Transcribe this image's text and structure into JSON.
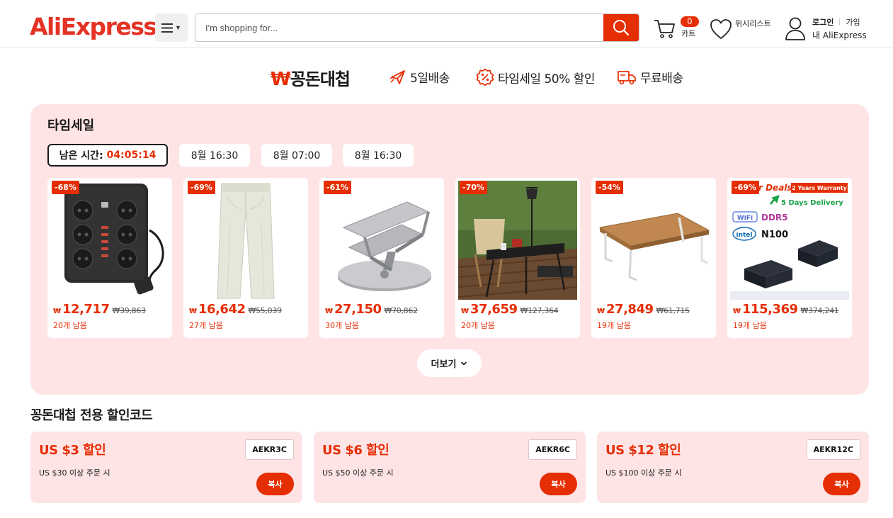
{
  "header": {
    "logo_text": "AliExpress",
    "logo_tm": "™",
    "search_placeholder": "I'm shopping for...",
    "cart_count": "0",
    "cart_label": "카트",
    "wishlist_label": "위시리스트",
    "login_label": "로그인",
    "join_label": "가입",
    "my_account_label": "내 AliExpress"
  },
  "banner": {
    "title_symbol": "₩",
    "title_text": "꽁돈대첩",
    "features": [
      {
        "icon": "airplane-icon",
        "label": "5일배송"
      },
      {
        "icon": "percent-badge-icon",
        "label": "타임세일 50% 할인"
      },
      {
        "icon": "truck-icon",
        "label": "무료배송"
      }
    ]
  },
  "timesale": {
    "title": "타임세일",
    "remaining_label": "남은 시간:",
    "countdown": "04:05:14",
    "slots": [
      "8월 16:30",
      "8월 07:00",
      "8월 16:30"
    ],
    "currency": "₩",
    "products": [
      {
        "name": "power strip",
        "discount": "-68%",
        "price": "12,717",
        "original": "₩39,863",
        "stock": "20개 남음"
      },
      {
        "name": "wide-leg pants",
        "discount": "-69%",
        "price": "16,642",
        "original": "₩55,039",
        "stock": "27개 남음"
      },
      {
        "name": "laptop stand",
        "discount": "-61%",
        "price": "27,150",
        "original": "₩70,862",
        "stock": "30개 남음"
      },
      {
        "name": "camping table",
        "discount": "-70%",
        "price": "37,659",
        "original": "₩127,364",
        "stock": "20개 남음"
      },
      {
        "name": "folding table",
        "discount": "-54%",
        "price": "27,849",
        "original": "₩61,715",
        "stock": "19개 남음"
      },
      {
        "name": "mini pc",
        "discount": "-69%",
        "price": "115,369",
        "original": "₩374,241",
        "stock": "19개 남음",
        "image_text": {
          "deals": "r Deals",
          "warranty": "2 Years Warranty",
          "delivery": "5 Days Delivery",
          "wifi": "WiFi",
          "ram": "DDR5",
          "brand": "intel",
          "cpu": "N100"
        }
      }
    ],
    "more_label": "더보기"
  },
  "coupons": {
    "title": "꽁돈대첩 전용 할인코드",
    "copy_label": "복사",
    "items": [
      {
        "amount": "US $3 할인",
        "condition": "US $30 이상 주문 시",
        "code": "AEKR3C"
      },
      {
        "amount": "US $6 할인",
        "condition": "US $50 이상 주문 시",
        "code": "AEKR6C"
      },
      {
        "amount": "US $12 할인",
        "condition": "US $100 이상 주문 시",
        "code": "AEKR12C"
      }
    ]
  },
  "colors": {
    "brand_red": "#e62e04",
    "panel_pink": "#ffe4e6"
  }
}
